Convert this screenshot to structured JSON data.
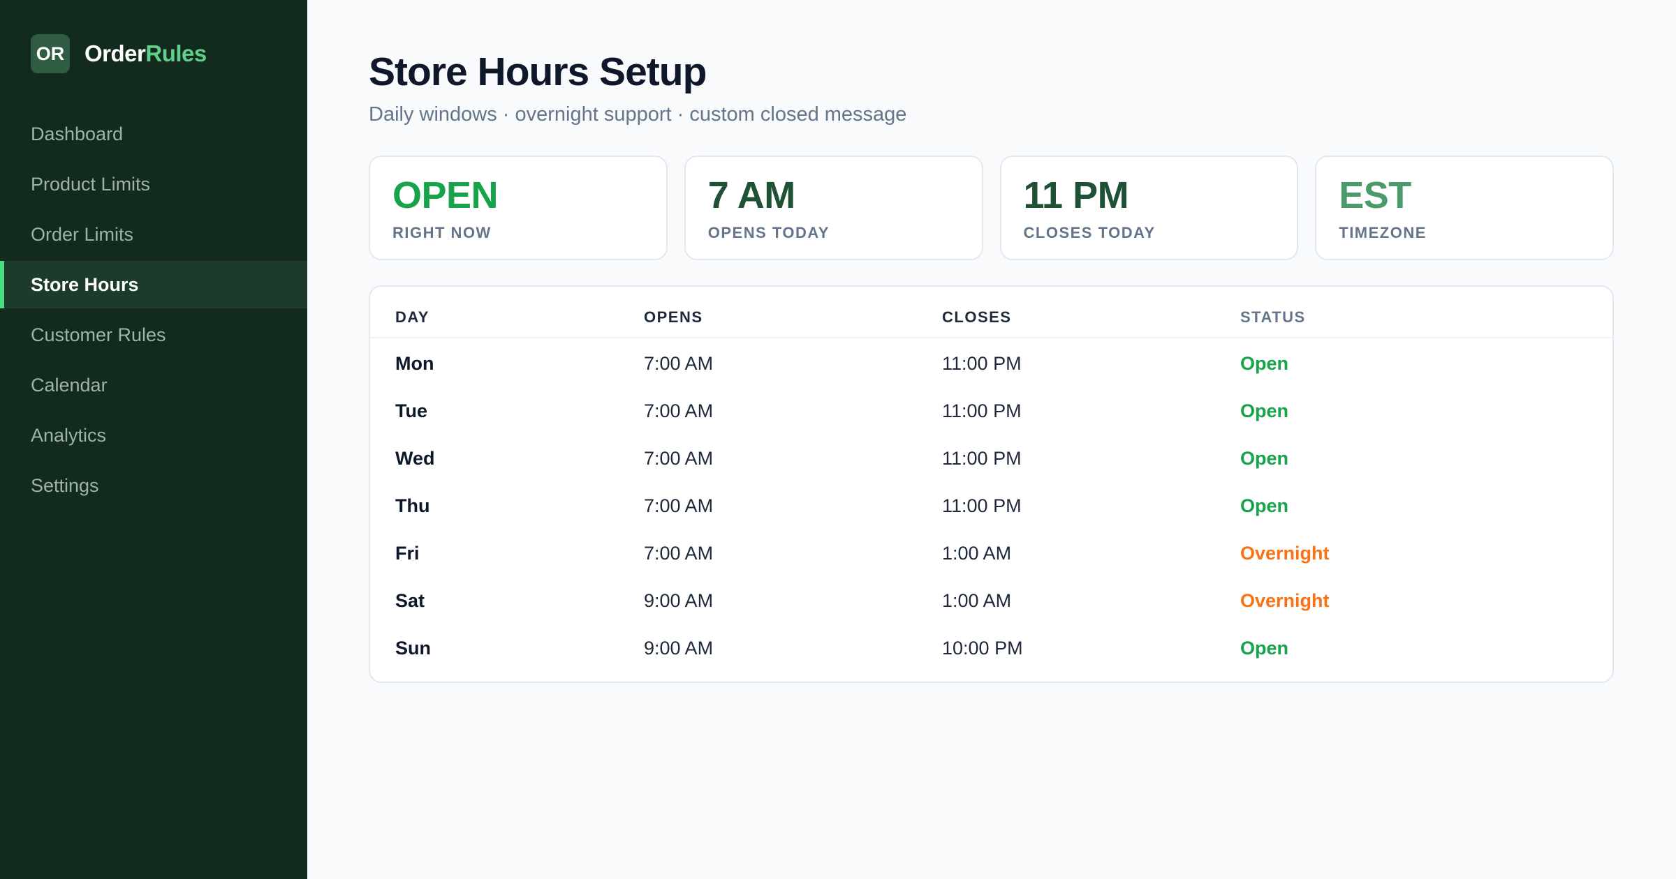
{
  "brand": {
    "badge": "OR",
    "name_prefix": "Order",
    "name_accent": "Rules"
  },
  "sidebar": {
    "items": [
      {
        "label": "Dashboard",
        "active": false
      },
      {
        "label": "Product Limits",
        "active": false
      },
      {
        "label": "Order Limits",
        "active": false
      },
      {
        "label": "Store Hours",
        "active": true
      },
      {
        "label": "Customer Rules",
        "active": false
      },
      {
        "label": "Calendar",
        "active": false
      },
      {
        "label": "Analytics",
        "active": false
      },
      {
        "label": "Settings",
        "active": false
      }
    ]
  },
  "header": {
    "title": "Store Hours Setup",
    "subtitle": "Daily windows · overnight support · custom closed message"
  },
  "stats": [
    {
      "value": "OPEN",
      "label": "RIGHT NOW",
      "color": "#16a34a"
    },
    {
      "value": "7 AM",
      "label": "OPENS TODAY",
      "color": "#1f5135"
    },
    {
      "value": "11 PM",
      "label": "CLOSES TODAY",
      "color": "#1f5135"
    },
    {
      "value": "EST",
      "label": "TIMEZONE",
      "color": "#4a9a6a"
    }
  ],
  "table": {
    "headers": {
      "day": "DAY",
      "opens": "OPENS",
      "closes": "CLOSES",
      "status": "STATUS"
    },
    "rows": [
      {
        "day": "Mon",
        "opens": "7:00 AM",
        "closes": "11:00 PM",
        "status": "Open"
      },
      {
        "day": "Tue",
        "opens": "7:00 AM",
        "closes": "11:00 PM",
        "status": "Open"
      },
      {
        "day": "Wed",
        "opens": "7:00 AM",
        "closes": "11:00 PM",
        "status": "Open"
      },
      {
        "day": "Thu",
        "opens": "7:00 AM",
        "closes": "11:00 PM",
        "status": "Open"
      },
      {
        "day": "Fri",
        "opens": "7:00 AM",
        "closes": "1:00 AM",
        "status": "Overnight"
      },
      {
        "day": "Sat",
        "opens": "9:00 AM",
        "closes": "1:00 AM",
        "status": "Overnight"
      },
      {
        "day": "Sun",
        "opens": "9:00 AM",
        "closes": "10:00 PM",
        "status": "Open"
      }
    ]
  },
  "status_colors": {
    "Open": "#16a34a",
    "Overnight": "#f97316"
  }
}
